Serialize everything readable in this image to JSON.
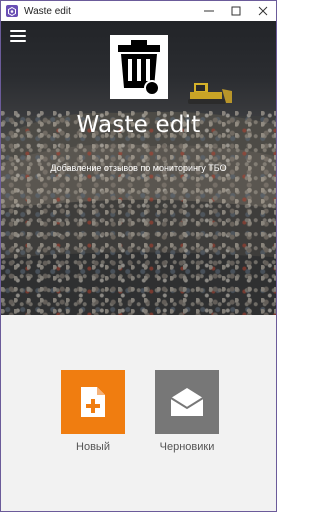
{
  "window": {
    "title": "Waste edit",
    "accent": "#6a4fb5"
  },
  "hero": {
    "title": "Waste edit",
    "subtitle": "Добавление отзывов по мониторингу ТБО",
    "logo_icon": "trash-bin-icon"
  },
  "actions": [
    {
      "label": "Новый",
      "icon": "new-document-icon",
      "color": "#f07d10"
    },
    {
      "label": "Черновики",
      "icon": "envelope-open-icon",
      "color": "#777777"
    }
  ]
}
